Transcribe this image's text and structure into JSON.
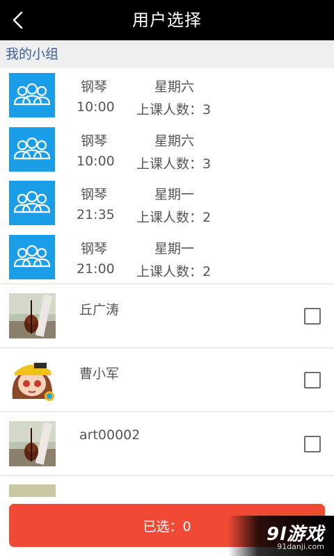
{
  "header": {
    "title": "用户选择"
  },
  "section": {
    "title": "我的小组"
  },
  "groups": [
    {
      "subject": "钢琴",
      "day": "星期六",
      "time": "10:00",
      "count_text": "上课人数：3"
    },
    {
      "subject": "钢琴",
      "day": "星期六",
      "time": "10:00",
      "count_text": "上课人数：3"
    },
    {
      "subject": "钢琴",
      "day": "星期一",
      "time": "21:35",
      "count_text": "上课人数：2"
    },
    {
      "subject": "钢琴",
      "day": "星期一",
      "time": "21:00",
      "count_text": "上课人数：2"
    }
  ],
  "users": [
    {
      "name": "丘广涛",
      "checked": false,
      "avatar": "violin-avatar"
    },
    {
      "name": "曹小军",
      "checked": false,
      "avatar": "cartoon-girl-avatar"
    },
    {
      "name": "art00002",
      "checked": false,
      "avatar": "violin-avatar"
    }
  ],
  "footer": {
    "selected_label": "已选：0"
  },
  "watermark": {
    "logo": "9l游戏",
    "url": "91danji.com"
  },
  "colors": {
    "header_bg": "#000000",
    "section_bg": "#efefef",
    "section_text": "#3b5f9e",
    "group_icon_bg": "#1b9ee8",
    "button_bg": "#f04a35"
  },
  "icons": {
    "back": "chevron-left-icon",
    "group": "group-people-icon",
    "checkbox": "checkbox-icon"
  }
}
